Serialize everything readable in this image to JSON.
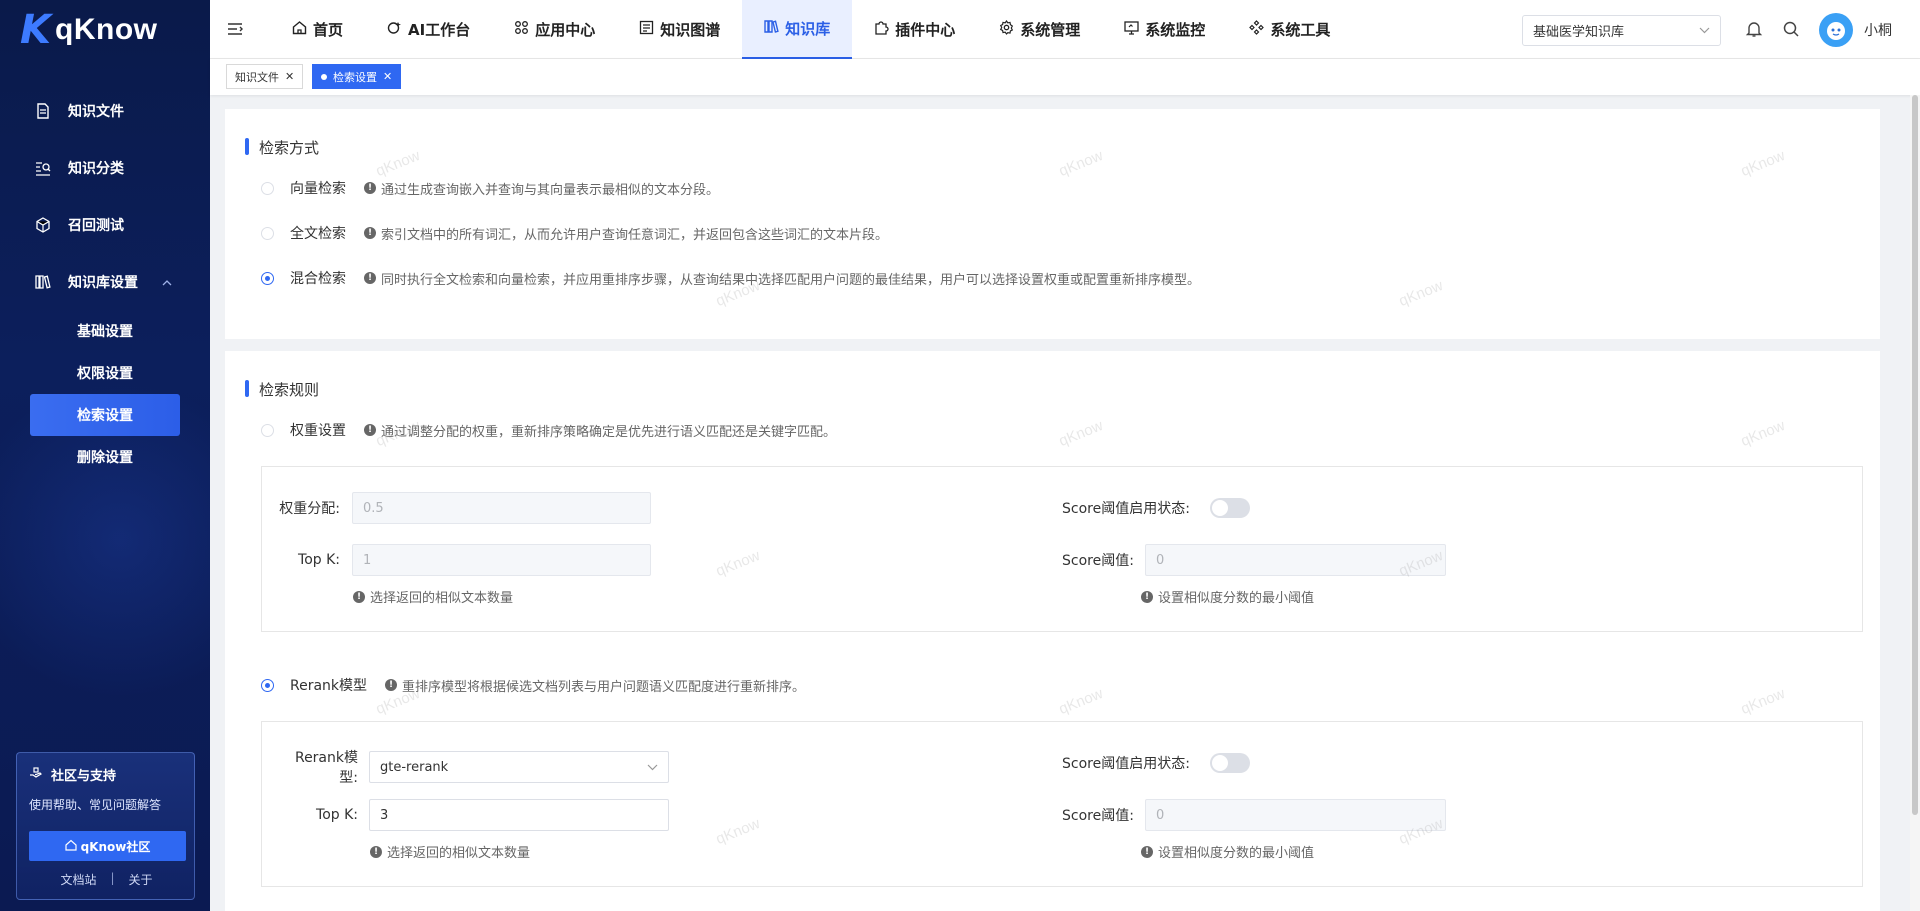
{
  "brand": {
    "logo_mark": "K",
    "name": "qKnow"
  },
  "sidebar": {
    "items": [
      {
        "label": "知识文件",
        "icon": "file-icon"
      },
      {
        "label": "知识分类",
        "icon": "category-search-icon"
      },
      {
        "label": "召回测试",
        "icon": "cube-icon"
      },
      {
        "label": "知识库设置",
        "icon": "library-icon"
      }
    ],
    "sub_items": [
      "基础设置",
      "权限设置",
      "检索设置",
      "删除设置"
    ],
    "active_sub": "检索设置"
  },
  "support": {
    "title": "社区与支持",
    "desc": "使用帮助、常见问题解答",
    "button": "qKnow社区",
    "links": [
      "文档站",
      "关于"
    ],
    "separator": "|"
  },
  "topbar": {
    "nav": [
      "首页",
      "AI工作台",
      "应用中心",
      "知识图谱",
      "知识库",
      "插件中心",
      "系统管理",
      "系统监控",
      "系统工具"
    ],
    "active": "知识库",
    "kb_select": "基础医学知识库",
    "username": "小桐"
  },
  "tabs": [
    {
      "label": "知识文件",
      "active": false
    },
    {
      "label": "检索设置",
      "active": true
    }
  ],
  "retrieval_method": {
    "title": "检索方式",
    "options": [
      {
        "label": "向量检索",
        "desc": "通过生成查询嵌入并查询与其向量表示最相似的文本分段。",
        "checked": false
      },
      {
        "label": "全文检索",
        "desc": "索引文档中的所有词汇，从而允许用户查询任意词汇，并返回包含这些词汇的文本片段。",
        "checked": false
      },
      {
        "label": "混合检索",
        "desc": "同时执行全文检索和向量检索，并应用重排序步骤，从查询结果中选择匹配用户问题的最佳结果，用户可以选择设置权重或配置重新排序模型。",
        "checked": true
      }
    ]
  },
  "retrieval_rules": {
    "title": "检索规则",
    "weight": {
      "label": "权重设置",
      "desc": "通过调整分配的权重，重新排序策略确定是优先进行语义匹配还是关键字匹配。",
      "checked": false,
      "weight_label": "权重分配:",
      "weight_value": "0.5",
      "topk_label": "Top K:",
      "topk_value": "1",
      "topk_hint": "选择返回的相似文本数量",
      "score_switch_label": "Score阈值启用状态:",
      "score_switch_on": false,
      "score_label": "Score阈值:",
      "score_value": "0",
      "score_hint": "设置相似度分数的最小阈值"
    },
    "rerank": {
      "label": "Rerank模型",
      "desc": "重排序模型将根据候选文档列表与用户问题语义匹配度进行重新排序。",
      "checked": true,
      "model_label": "Rerank模型:",
      "model_value": "gte-rerank",
      "topk_label": "Top K:",
      "topk_value": "3",
      "topk_hint": "选择返回的相似文本数量",
      "score_switch_label": "Score阈值启用状态:",
      "score_switch_on": false,
      "score_label": "Score阈值:",
      "score_value": "0",
      "score_hint": "设置相似度分数的最小阈值"
    }
  },
  "watermark_text": "qKnow",
  "colors": {
    "primary": "#2f68f2",
    "sidebar_bg": "#0c1f5c"
  }
}
